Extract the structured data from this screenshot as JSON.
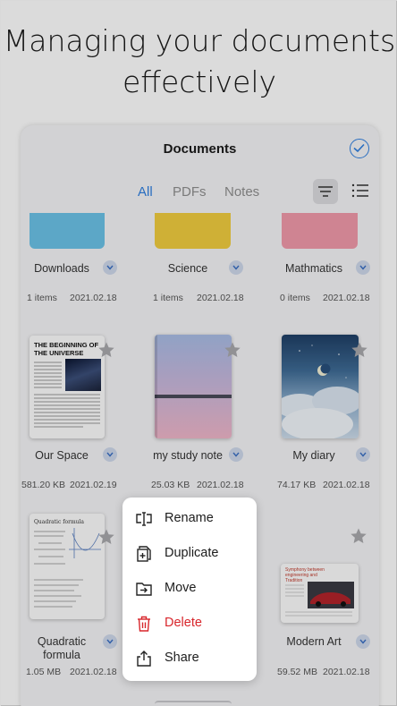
{
  "headline": {
    "line1": "Managing your documents",
    "line2": "effectively"
  },
  "app": {
    "title": "Documents",
    "tabs": [
      {
        "label": "All",
        "active": true
      },
      {
        "label": "PDFs",
        "active": false
      },
      {
        "label": "Notes",
        "active": false
      }
    ]
  },
  "folders": [
    {
      "name": "Downloads",
      "count": "1 items",
      "date": "2021.02.18",
      "color": "#6cc3e8"
    },
    {
      "name": "Science",
      "count": "1 items",
      "date": "2021.02.18",
      "color": "#f1cd3f"
    },
    {
      "name": "Mathmatics",
      "count": "0 items",
      "date": "2021.02.18",
      "color": "#f29aab"
    }
  ],
  "files": [
    {
      "name": "Our Space",
      "size": "581.20 KB",
      "date": "2021.02.19"
    },
    {
      "name": "my study note",
      "size": "25.03 KB",
      "date": "2021.02.18"
    },
    {
      "name": "My diary",
      "size": "74.17 KB",
      "date": "2021.02.18"
    },
    {
      "name": "Quadratic formula",
      "size": "1.05 MB",
      "date": "2021.02.18"
    },
    {
      "name": "Modern Art",
      "size": "59.52 MB",
      "date": "2021.02.18"
    }
  ],
  "thumb_text": {
    "space_title": "THE BEGINNING OF THE UNIVERSE",
    "math_title": "Quadratic formula",
    "art_title": "Symphony between engineering and Tradition"
  },
  "context_menu": {
    "items": [
      {
        "label": "Rename",
        "icon": "rename-icon",
        "danger": false
      },
      {
        "label": "Duplicate",
        "icon": "duplicate-icon",
        "danger": false
      },
      {
        "label": "Move",
        "icon": "move-icon",
        "danger": false
      },
      {
        "label": "Delete",
        "icon": "trash-icon",
        "danger": true
      },
      {
        "label": "Share",
        "icon": "share-icon",
        "danger": false
      }
    ]
  },
  "colors": {
    "accent": "#2f7fe0",
    "danger": "#d8262c"
  }
}
